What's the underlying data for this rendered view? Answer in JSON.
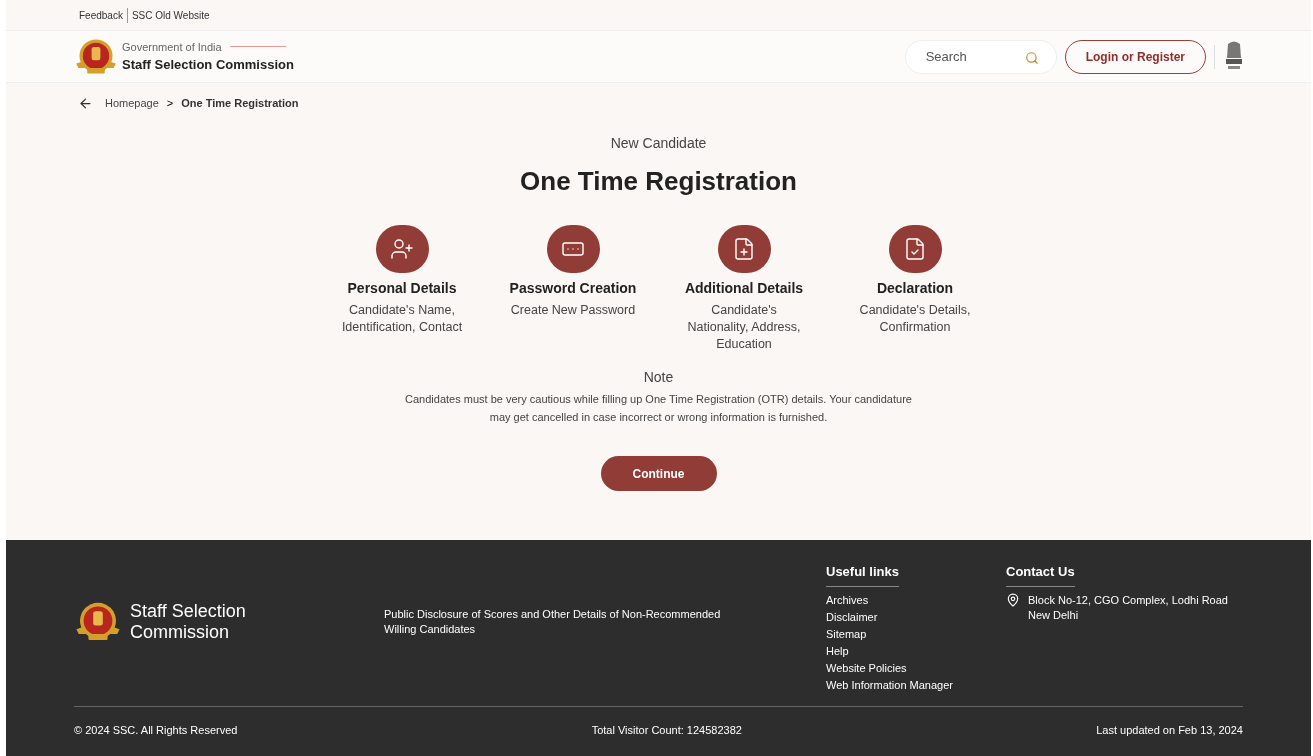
{
  "top_links": [
    "Feedback",
    "SSC Old Website"
  ],
  "header": {
    "subtitle": "Government of India",
    "title": "Staff Selection Commission",
    "search": {
      "placeholder": "Search"
    },
    "login_button": "Login or Register"
  },
  "breadcrumb": [
    "Homepage",
    ">",
    "One Time Registration"
  ],
  "hero": {
    "eyebrow": "New Candidate",
    "title": "One Time Registration"
  },
  "steps": [
    {
      "kind": "person",
      "title": "Personal Details",
      "lines": [
        "Candidate's Name,",
        "Identification, Contact"
      ]
    },
    {
      "kind": "password",
      "title": "Password Creation",
      "lines": [
        "Create New Password"
      ]
    },
    {
      "kind": "add-document",
      "title": "Additional Details",
      "lines": [
        "Candidate's",
        "Nationality, Address,",
        "Education"
      ]
    },
    {
      "kind": "check-document",
      "title": "Declaration",
      "lines": [
        "Candidate's Details,",
        "Confirmation"
      ]
    }
  ],
  "note": {
    "heading": "Note",
    "lines": [
      "Candidates must be very cautious while filling up One Time Registration (OTR) details. Your candidature",
      "may get cancelled in case incorrect or wrong information is furnished."
    ]
  },
  "continue_button": "Continue",
  "footer": {
    "brand": [
      "Staff Selection",
      "Commission"
    ],
    "disclosure": [
      "Public Disclosure of Scores and Other Details of Non-Recommended",
      "Willing Candidates"
    ],
    "useful_links": {
      "heading": "Useful links",
      "items": [
        "Archives",
        "Disclaimer",
        "Sitemap",
        "Help",
        "Website Policies",
        "Web Information Manager"
      ]
    },
    "contact": {
      "heading": "Contact Us",
      "address": [
        "Block No-12, CGO Complex, Lodhi Road",
        "New Delhi"
      ]
    },
    "copyright": "© 2024 SSC. All Rights Reserved",
    "visitor_count": "Total Visitor Count: 124582382",
    "last_updated": "Last updated on Feb 13, 2024"
  }
}
